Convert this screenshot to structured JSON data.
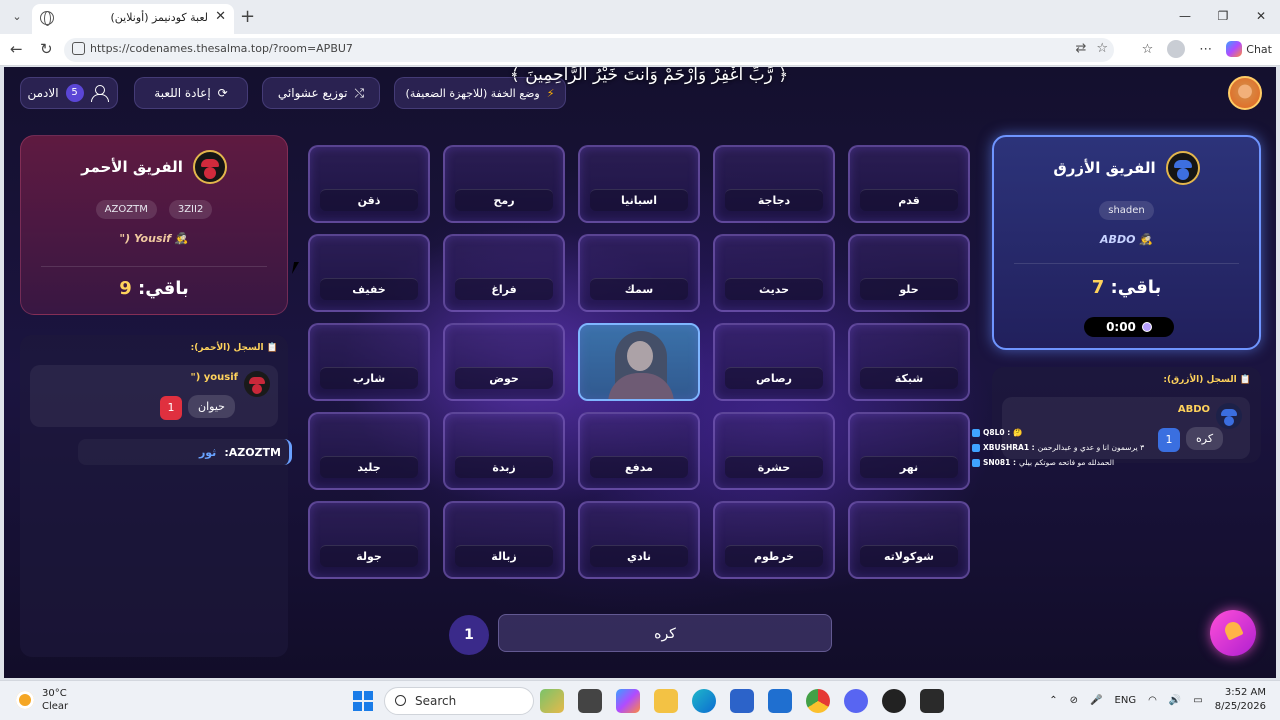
{
  "browser": {
    "tab_title": "لعبة كودنيمز (أونلاين)",
    "url": "https://codenames.thesalma.top/?room=APBU7",
    "chat_label": "Chat"
  },
  "verse": "﴿ رَّبِّ اغْفِرْ وَارْحَمْ وَأَنتَ خَيْرُ الرَّاحِمِينَ ﴾",
  "header": {
    "admin_count": "5",
    "admin_label": "الادمن",
    "restart_label": "إعادة اللعبة",
    "shuffle_label": "توزيع عشوائي",
    "lite_mode_label": "وضع الخفة (للاجهزة الضعيفة)"
  },
  "red_team": {
    "name": "الفريق الأحمر",
    "players": [
      "AZOZTM",
      "3ZII2"
    ],
    "spymaster": "\") Yousif 🕵",
    "remaining_label": "باقي:",
    "remaining": "9",
    "log_title": "📋 السجل (الأحمر):",
    "log_player": "\") yousif",
    "clue_word": "حيوان",
    "clue_number": "1",
    "guess_player": "AZOZTM:",
    "guess_word": "ثور"
  },
  "blue_team": {
    "name": "الفريق الأزرق",
    "players": [
      "shaden"
    ],
    "spymaster": "ABDO 🕵",
    "remaining_label": "باقي:",
    "remaining": "7",
    "timer": "0:00",
    "log_title": "📋 السجل (الأزرق):",
    "log_player": "ABDO",
    "clue_word": "كره",
    "clue_number": "1"
  },
  "board": {
    "rows": [
      [
        "ذقن",
        "رمح",
        "اسبانيا",
        "دجاجة",
        "قدم"
      ],
      [
        "خفيف",
        "فراغ",
        "سمك",
        "حديث",
        "حلو"
      ],
      [
        "شارب",
        "حوض",
        "",
        "رصاص",
        "شبكة"
      ],
      [
        "جليد",
        "زبدة",
        "مدفع",
        "حشرة",
        "نهر"
      ],
      [
        "جولة",
        "زبالة",
        "نادي",
        "خرطوم",
        "شوكولاته"
      ]
    ],
    "revealed": [
      [
        2,
        2
      ]
    ]
  },
  "clue_input": {
    "word": "كره",
    "number": "1"
  },
  "stream_chat": [
    {
      "name": "Q8L0 :",
      "msg": "🤔"
    },
    {
      "name": "XBUSHRA1 :",
      "msg": "٣ يرسمون انا و عدي و عبدالرحمن"
    },
    {
      "name": "SN081 :",
      "msg": "الحمدلله مو فاتحه صوتكم بيلي"
    }
  ],
  "taskbar": {
    "temperature": "30°C",
    "condition": "Clear",
    "search_label": "Search",
    "lang": "ENG",
    "time": "3:52 AM",
    "date": "8/25/2026"
  },
  "colors": {
    "accent_red": "#d12a3c",
    "accent_blue": "#3d6fe0",
    "gold": "#ffd35c",
    "board_border": "#8c6ed2"
  }
}
